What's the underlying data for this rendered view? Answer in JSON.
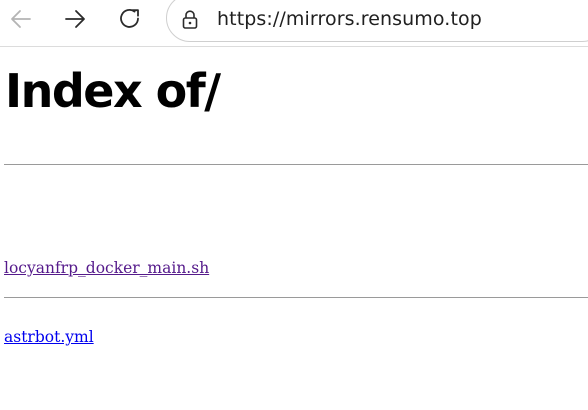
{
  "browser": {
    "url": "https://mirrors.rensumo.top",
    "icons": {
      "back": "back-arrow-icon",
      "forward": "forward-arrow-icon",
      "reload": "reload-icon",
      "lock": "lock-icon"
    },
    "colors": {
      "icon_disabled": "#b4b4b4",
      "icon_active": "#2b2b2b"
    }
  },
  "page": {
    "title": "Index of/",
    "files": [
      {
        "name": "locyanfrp_docker_main.sh",
        "visited": true
      },
      {
        "name": "astrbot.yml",
        "visited": false
      }
    ],
    "colors": {
      "link_visited": "#551a8b",
      "link_unvisited": "#0000ee",
      "rule": "#9a9a9a"
    }
  }
}
